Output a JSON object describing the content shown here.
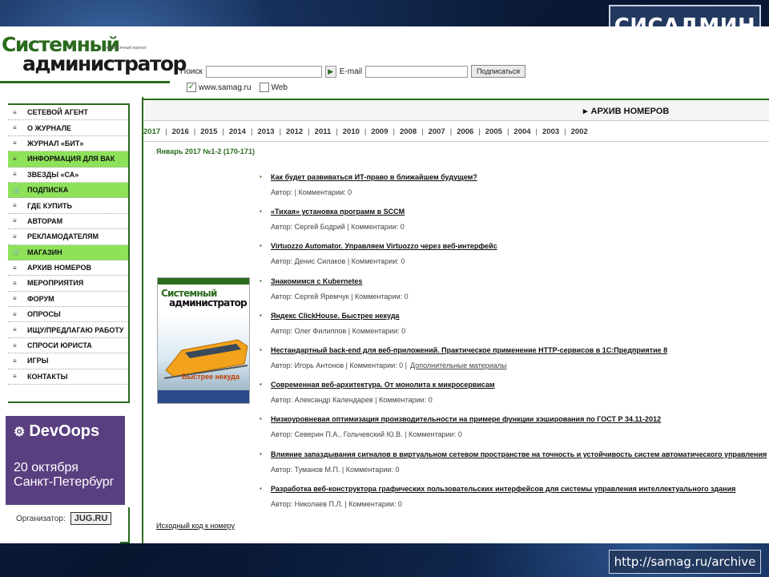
{
  "slide": {
    "badge": "СИСАДМИН",
    "url": "http://samag.ru/archive"
  },
  "logo": {
    "line1": "Системный",
    "line2": "администратор",
    "tagline": "ежемесячный журнал"
  },
  "search": {
    "label": "Поиск",
    "go": "▶",
    "email_label": "E-mail",
    "subscribe": "Подписаться",
    "opt_site": "www.samag.ru",
    "opt_web": "Web"
  },
  "sidebar": {
    "items": [
      {
        "label": "СЕТЕВОЙ АГЕНТ",
        "icon": "≡"
      },
      {
        "label": "О ЖУРНАЛЕ",
        "icon": "≡"
      },
      {
        "label": "ЖУРНАЛ «БИТ»",
        "icon": "≡"
      },
      {
        "label": "ИНФОРМАЦИЯ ДЛЯ ВАК",
        "icon": "≡"
      },
      {
        "label": "ЗВЕЗДЫ «СА»",
        "icon": "≡"
      },
      {
        "label": "ПОДПИСКА",
        "icon": "🛒"
      },
      {
        "label": "ГДЕ КУПИТЬ",
        "icon": "≡"
      },
      {
        "label": "АВТОРАМ",
        "icon": "≡"
      },
      {
        "label": "РЕКЛАМОДАТЕЛЯМ",
        "icon": "≡"
      },
      {
        "label": "МАГАЗИН",
        "icon": "🛒"
      },
      {
        "label": "АРХИВ НОМЕРОВ",
        "icon": "≡"
      },
      {
        "label": "МЕРОПРИЯТИЯ",
        "icon": "≡"
      },
      {
        "label": "ФОРУМ",
        "icon": "≡"
      },
      {
        "label": "ОПРОСЫ",
        "icon": "≡"
      },
      {
        "label": "ИЩУ/ПРЕДЛАГАЮ РАБОТУ",
        "icon": "≡"
      },
      {
        "label": "СПРОСИ ЮРИСТА",
        "icon": "≡"
      },
      {
        "label": "ИГРЫ",
        "icon": "≡"
      },
      {
        "label": "КОНТАКТЫ",
        "icon": "≡"
      }
    ]
  },
  "ad": {
    "title": "DevOops",
    "date_line1": "20 октября",
    "date_line2": "Санкт-Петербург",
    "organizer_label": "Организатор:",
    "organizer_logo": "JUG.RU"
  },
  "archive": {
    "title": "АРХИВ НОМЕРОВ",
    "years": [
      "2017",
      "2016",
      "2015",
      "2014",
      "2013",
      "2012",
      "2011",
      "2010",
      "2009",
      "2008",
      "2007",
      "2006",
      "2005",
      "2004",
      "2003",
      "2002"
    ],
    "issue_title": "Январь 2017 №1-2 (170-171)",
    "cover": {
      "line1": "Системный",
      "line2": "администратор",
      "headline": "Быстрее некуда"
    },
    "articles": [
      {
        "title": "Как будет развиваться ИТ-право в ближайшем будущем?",
        "meta": "Автор: | Комментарии: 0"
      },
      {
        "title": "«Тихая» установка программ в SCCM",
        "meta": "Автор: Сергей Бодрий | Комментарии: 0"
      },
      {
        "title": "Virtuozzo Automator. Управляем Virtuozzo через веб-интерфейс",
        "meta": "Автор: Денис Силаков | Комментарии: 0"
      },
      {
        "title": "Знакомимся с Kubernetes",
        "meta": "Автор: Сергей Яремчук | Комментарии: 0"
      },
      {
        "title": "Яндекс ClickHouse. Быстрее некуда",
        "meta": "Автор: Олег Филиппов | Комментарии: 0"
      },
      {
        "title": "Нестандартный back-end для веб-приложений. Практическое применение HTTP-сервисов в 1С:Предприятие 8",
        "meta": "Автор: Игорь Антонов | Комментарии: 0 |",
        "extra": "Дополнительные материалы"
      },
      {
        "title": "Современная веб-архитектура. От монолита к микросервисам",
        "meta": "Автор: Александр Календарев | Комментарии: 0"
      },
      {
        "title": "Низкоуровневая оптимизация производительности на примере функции хэширования по ГОСТ Р 34.11-2012",
        "meta": "Автор: Северин П.А., Гольчевский Ю.В. | Комментарии: 0"
      },
      {
        "title": "Влияние запаздывания сигналов в виртуальном сетевом пространстве на точность и устойчивость систем автоматического управления",
        "meta": "Автор: Туманов М.П. | Комментарии: 0"
      },
      {
        "title": "Разработка веб-конструктора графических пользовательских интерфейсов для системы управления интеллектуального здания",
        "meta": "Автор: Николаев П.Л. | Комментарии: 0"
      }
    ],
    "source_link": "Исходный код к номеру"
  }
}
